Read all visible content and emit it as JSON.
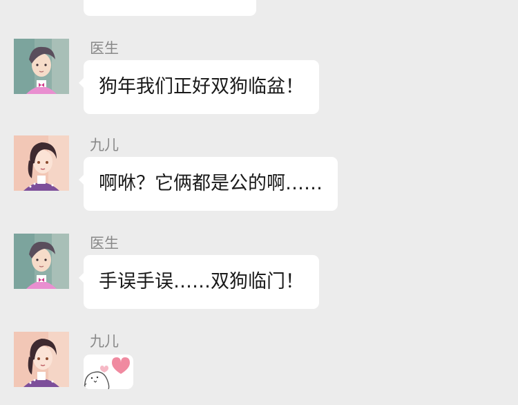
{
  "chat": {
    "messages": [
      {
        "sender": "医生",
        "avatar": "doctor-avatar",
        "text": "狗年我们正好双狗临盆！"
      },
      {
        "sender": "九儿",
        "avatar": "jiuer-avatar",
        "text": "啊咻？它俩都是公的啊……"
      },
      {
        "sender": "医生",
        "avatar": "doctor-avatar",
        "text": "手误手误……双狗临门！"
      },
      {
        "sender": "九儿",
        "avatar": "jiuer-avatar",
        "sticker": "heart-bird-sticker"
      }
    ]
  },
  "colors": {
    "background": "#ececec",
    "bubble": "#ffffff",
    "sender_name": "#888888",
    "message_text": "#1a1a1a",
    "sticker_heart": "#f08aa0"
  }
}
